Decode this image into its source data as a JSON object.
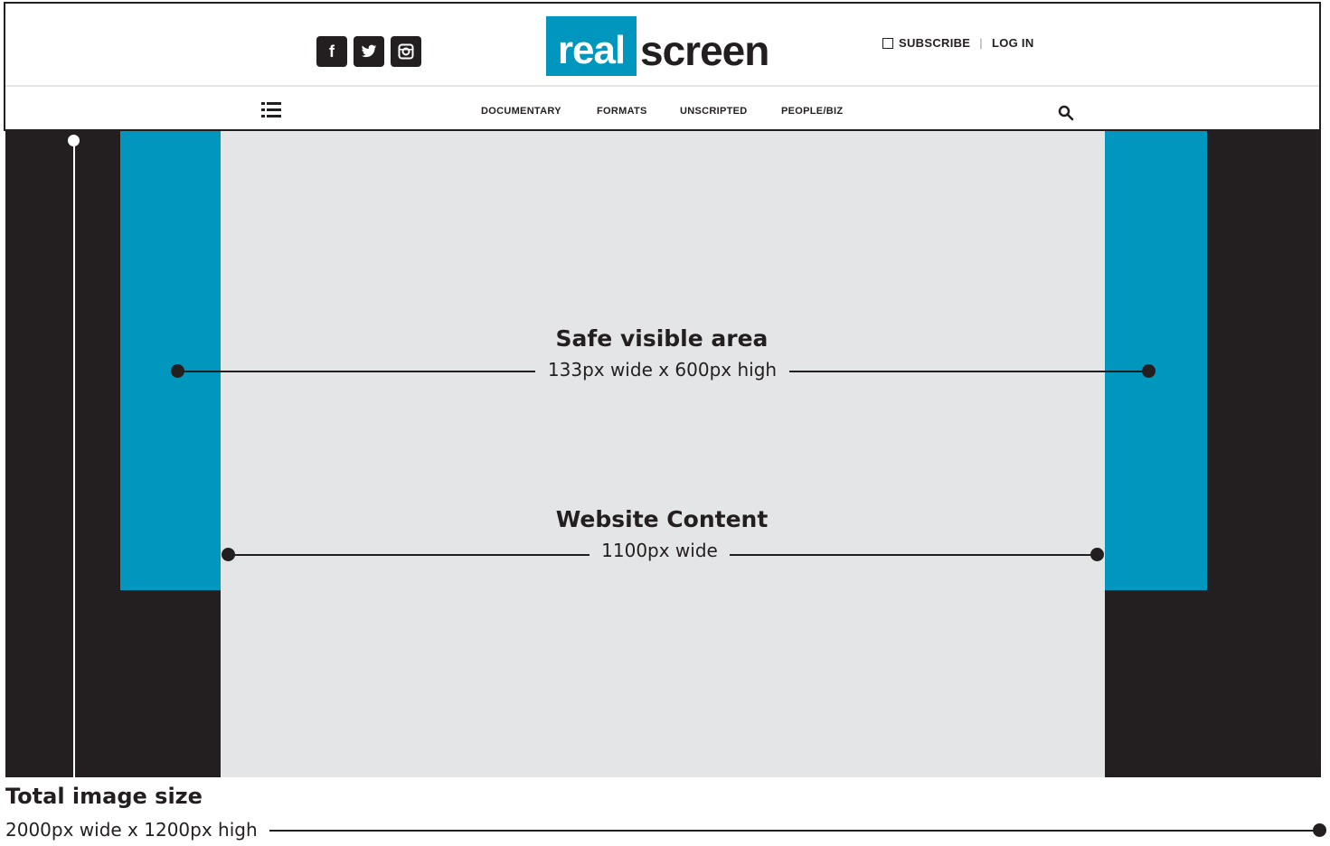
{
  "header": {
    "social_icons": [
      {
        "name": "facebook-icon",
        "glyph": "f"
      },
      {
        "name": "twitter-icon",
        "glyph": "t"
      },
      {
        "name": "instagram-icon",
        "glyph": "ig"
      }
    ],
    "logo": {
      "highlight": "real",
      "rest": "screen",
      "brand_color": "#0096bd"
    },
    "account": {
      "subscribe": "SUBSCRIBE",
      "separator": "|",
      "login": "LOG IN"
    },
    "nav": [
      "DOCUMENTARY",
      "FORMATS",
      "UNSCRIPTED",
      "PEOPLE/BIZ"
    ],
    "menu_icon": "hamburger-icon",
    "search_icon": "search-icon"
  },
  "diagram": {
    "safe_area": {
      "title": "Safe visible area",
      "size": "133px wide x 600px high"
    },
    "website_content": {
      "title": "Website Content",
      "size": "1100px wide"
    },
    "total": {
      "title": "Total image size",
      "size": "2000px wide x 1200px high"
    },
    "colors": {
      "dark": "#231f20",
      "accent": "#0096bd",
      "content_bg": "#e4e5e6"
    }
  }
}
